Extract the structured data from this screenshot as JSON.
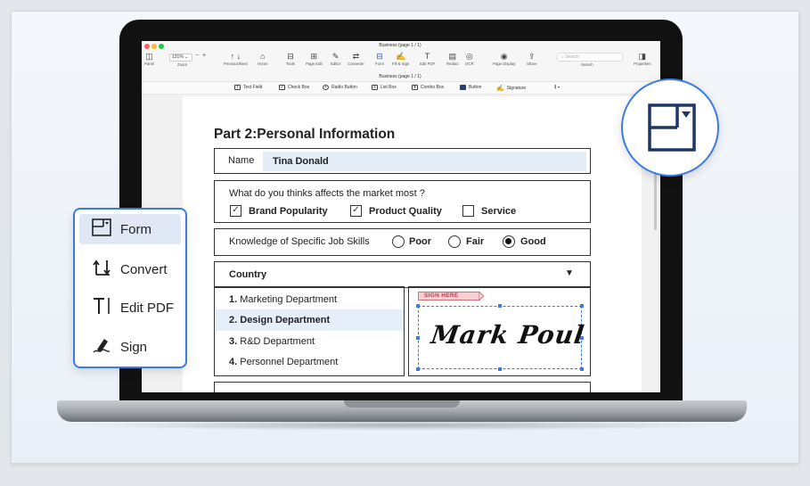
{
  "window": {
    "title": "Business (page 1 / 1)",
    "subtitle": "Business (page 1 / 1)",
    "zoom": "131%",
    "search_placeholder": "Search"
  },
  "toolbar": {
    "panel": "Panel",
    "zoom": "Zoom",
    "prevnext": "Previous/Next",
    "home": "Home",
    "tools": "Tools",
    "pageedit": "Page Edit",
    "editor": "Editor",
    "converter": "Converter",
    "form": "Form",
    "fillsign": "Fill & Sign",
    "editpdf": "Edit PDF",
    "redact": "Redact",
    "ocr": "OCR",
    "pagedisplay": "Page Display",
    "share": "Share",
    "search": "Search",
    "properties": "Properties"
  },
  "form_toolbar": {
    "text_field": "Text Field",
    "check_box": "Check Box",
    "radio_button": "Radio Button",
    "list_box": "List Box",
    "combo_box": "Combo Box",
    "button": "Button",
    "signature": "Signature"
  },
  "doc": {
    "heading": "Part 2:Personal Information",
    "name_label": "Name",
    "name_value": "Tina Donald",
    "question": "What do you thinks affects the market most ?",
    "opt1": "Brand Popularity",
    "opt2": "Product Quality",
    "opt3": "Service",
    "skills_label": "Knowledge of Specific Job Skills",
    "poor": "Poor",
    "fair": "Fair",
    "good": "Good",
    "country": "Country",
    "list": [
      {
        "num": "1.",
        "label": "Marketing Department"
      },
      {
        "num": "2.",
        "label": "Design Department"
      },
      {
        "num": "3.",
        "label": "R&D Department"
      },
      {
        "num": "4.",
        "label": "Personnel Department"
      }
    ],
    "sign_here": "SIGN HERE",
    "signature": "Mark Poul"
  },
  "side_panel": {
    "items": [
      {
        "label": "Form",
        "icon": "form-icon"
      },
      {
        "label": "Convert",
        "icon": "convert-icon"
      },
      {
        "label": "Edit PDF",
        "icon": "edit-pdf-icon"
      },
      {
        "label": "Sign",
        "icon": "sign-icon"
      }
    ]
  },
  "colors": {
    "accent": "#3a7de0",
    "icon_dark": "#1f3763",
    "sign_tag": "#c73a4a"
  }
}
